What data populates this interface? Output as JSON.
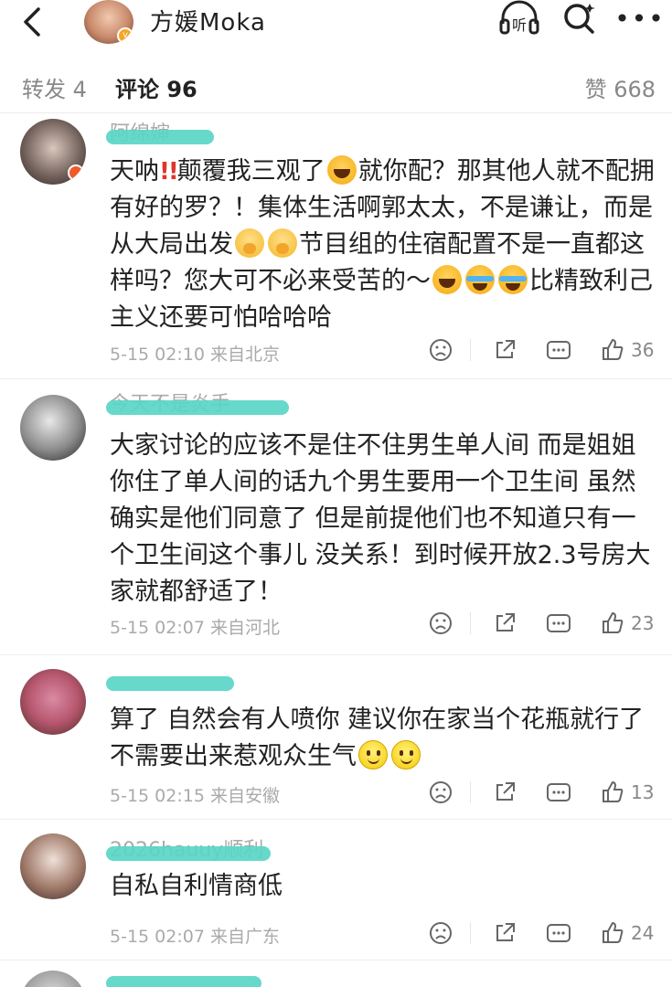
{
  "header": {
    "title": "方媛Moka",
    "listen_label": "听",
    "more_label": "•••"
  },
  "tabs": [
    {
      "label": "转发 4"
    },
    {
      "label": "评论 96"
    },
    {
      "label": "赞 668"
    }
  ],
  "comments": [
    {
      "name": "阿绵婶",
      "text_parts": [
        "天呐",
        "!!",
        "颠覆我三观了",
        "就你配？那其他人就不配拥有好的罗？！集体生活啊郭太太，不是谦让，而是从大局出发",
        "节目组的住宿配置不是一直都这样吗？您大可不必来受苦的～",
        "比精致利己主义还要可怕哈哈哈"
      ],
      "time": "5-15 02:10",
      "location": "来自北京",
      "likes": "36"
    },
    {
      "name": "今天不是炎手",
      "text": "大家讨论的应该不是住不住男生单人间 而是姐姐你住了单人间的话九个男生要用一个卫生间 虽然确实是他们同意了 但是前提他们也不知道只有一个卫生间这个事儿 没关系！到时候开放2.3号房大家就都舒适了！",
      "time": "5-15 02:07",
      "location": "来自河北",
      "likes": "23"
    },
    {
      "name": "",
      "text": "算了 自然会有人喷你 建议你在家当个花瓶就行了 不需要出来惹观众生气",
      "time": "5-15 02:15",
      "location": "来自安徽",
      "likes": "13"
    },
    {
      "name": "2026hauuy顺利",
      "text": "自私自利情商低",
      "time": "5-15 02:07",
      "location": "来自广东",
      "likes": "24"
    }
  ],
  "colors": {
    "accent": "#f5a623",
    "name_highlight": "#59d6c6",
    "meta_gray": "#aaaaaa"
  }
}
